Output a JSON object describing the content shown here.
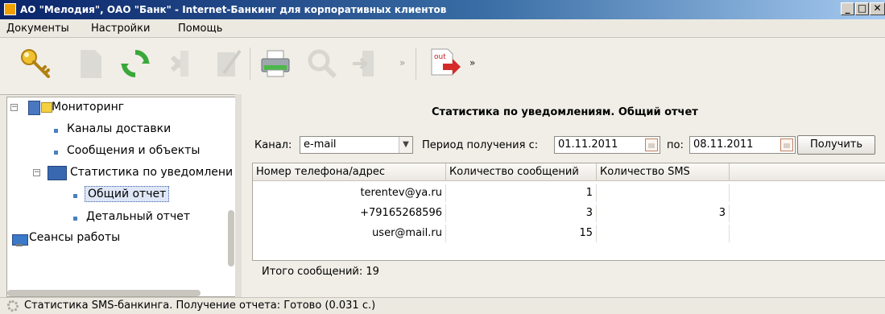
{
  "window": {
    "title": "АО \"Мелодия\", ОАО \"Банк\" - Internet-Банкинг для корпоративных клиентов"
  },
  "menu": [
    "Документы",
    "Настройки",
    "Помощь"
  ],
  "tree": {
    "items": [
      {
        "label": "Мониторинг"
      },
      {
        "label": "Каналы доставки"
      },
      {
        "label": "Сообщения и объекты"
      },
      {
        "label": "Статистика по уведомлени"
      },
      {
        "label": "Общий отчет"
      },
      {
        "label": "Детальный отчет"
      },
      {
        "label": "Сеансы работы"
      }
    ]
  },
  "report": {
    "title": "Статистика по уведомлениям. Общий отчет",
    "channel_label": "Канал:",
    "channel_value": "e-mail",
    "period_from_label": "Период получения с:",
    "period_from_value": "01.11.2011",
    "period_to_label": "по:",
    "period_to_value": "08.11.2011",
    "get_button": "Получить",
    "columns": [
      "Номер телефона/адрес",
      "Количество сообщений",
      "Количество SMS"
    ],
    "rows": [
      {
        "address": "terentev@ya.ru",
        "messages": "1",
        "sms": ""
      },
      {
        "address": "+79165268596",
        "messages": "3",
        "sms": "3"
      },
      {
        "address": "user@mail.ru",
        "messages": "15",
        "sms": ""
      }
    ],
    "total_label": "Итого сообщений:",
    "total_value": "19"
  },
  "status": {
    "text": "Статистика SMS-банкинга. Получение отчета: Готово (0.031 с.)"
  },
  "toolbar": {
    "out_label": "out"
  }
}
